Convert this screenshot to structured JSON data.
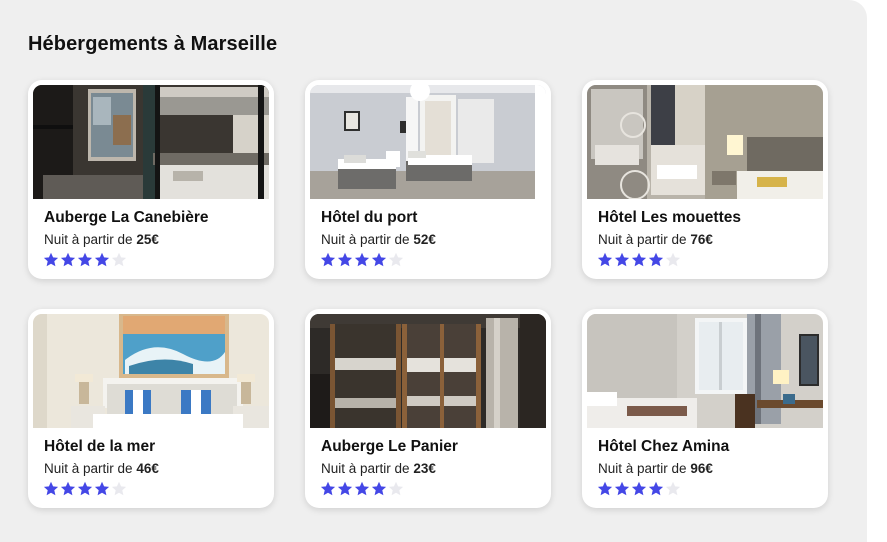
{
  "section_title": "Hébergements à Marseille",
  "price_prefix": "Nuit à partir de",
  "currency": "€",
  "colors": {
    "star_active": "#4447e6",
    "star_inactive": "#e9e9ee",
    "panel_bg": "#efefef"
  },
  "rating_max": 5,
  "listings": [
    {
      "name": "Auberge La Canebière",
      "price": "25",
      "rating": 4,
      "photo": "bunk-dorm-window-icon"
    },
    {
      "name": "Hôtel du port",
      "price": "52",
      "rating": 4,
      "photo": "twin-beds-room-icon"
    },
    {
      "name": "Hôtel Les mouettes",
      "price": "76",
      "rating": 4,
      "photo": "mirror-room-icon"
    },
    {
      "name": "Hôtel de la mer",
      "price": "46",
      "rating": 4,
      "photo": "sea-painting-room-icon"
    },
    {
      "name": "Auberge Le Panier",
      "price": "23",
      "rating": 4,
      "photo": "wooden-bunks-dorm-icon"
    },
    {
      "name": "Hôtel Chez Amina",
      "price": "96",
      "rating": 4,
      "photo": "desk-window-room-icon"
    }
  ]
}
